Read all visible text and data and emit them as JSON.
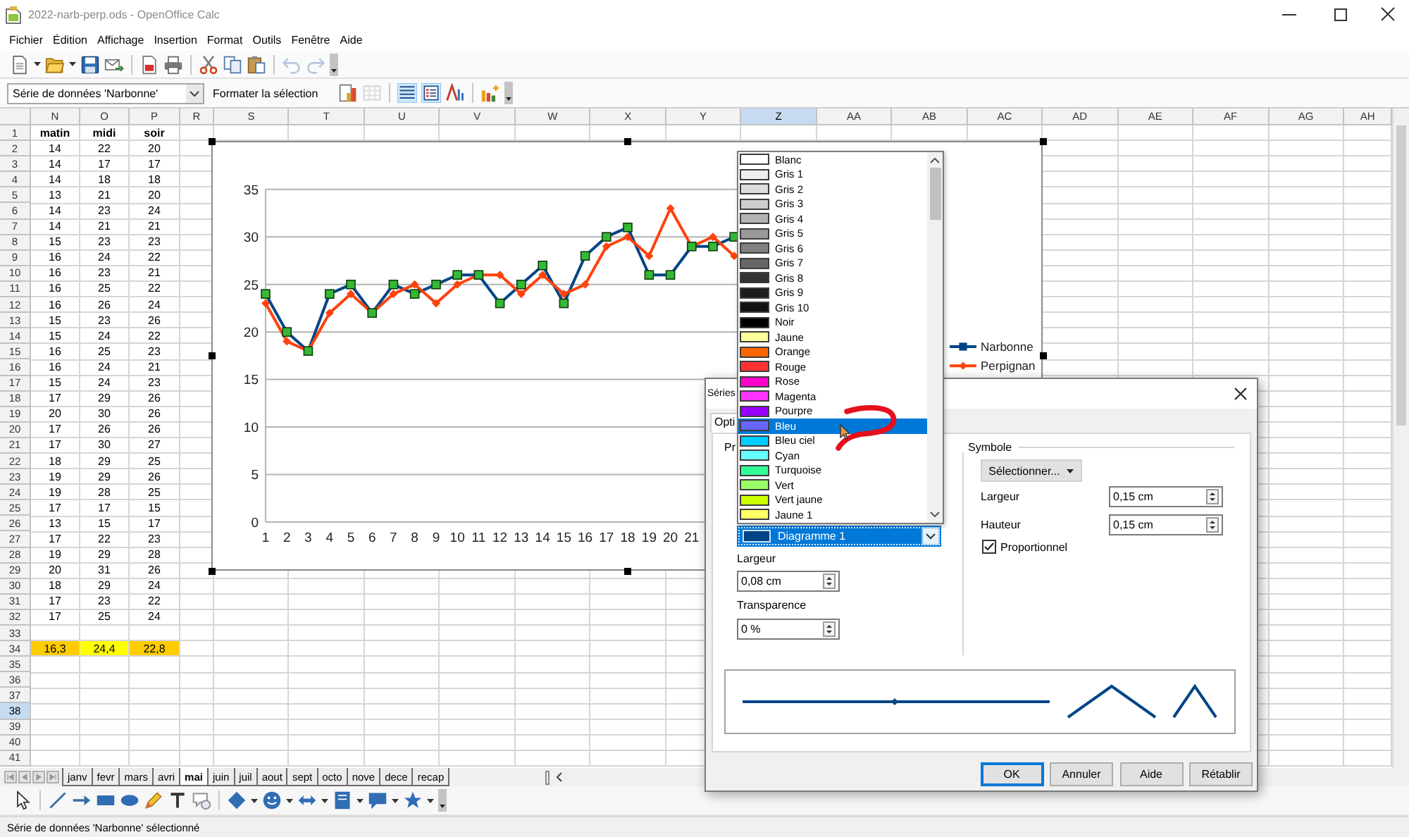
{
  "window": {
    "title": "2022-narb-perp.ods - OpenOffice Calc"
  },
  "menu": [
    "Fichier",
    "Édition",
    "Affichage",
    "Insertion",
    "Format",
    "Outils",
    "Fenêtre",
    "Aide"
  ],
  "toolbar": [
    {
      "kind": "new",
      "disabled": false
    },
    {
      "kind": "caret",
      "disabled": false
    },
    {
      "kind": "open",
      "disabled": false
    },
    {
      "kind": "caret",
      "disabled": false
    },
    {
      "kind": "save",
      "disabled": false
    },
    {
      "kind": "email",
      "disabled": false
    },
    {
      "kind": "separator"
    },
    {
      "kind": "pdf",
      "disabled": false
    },
    {
      "kind": "print",
      "disabled": false
    },
    {
      "kind": "separator"
    },
    {
      "kind": "cut",
      "disabled": false
    },
    {
      "kind": "copy",
      "disabled": false
    },
    {
      "kind": "paste",
      "disabled": false
    },
    {
      "kind": "separator"
    },
    {
      "kind": "undo",
      "disabled": true
    },
    {
      "kind": "redo",
      "disabled": true
    },
    {
      "kind": "overflow",
      "disabled": false
    }
  ],
  "format_bar": {
    "selector": "Série de données 'Narbonne'",
    "button": "Formater la sélection",
    "items": [
      {
        "kind": "chart-type",
        "disabled": false,
        "pressed": false
      },
      {
        "kind": "data-table",
        "disabled": true,
        "pressed": false
      },
      {
        "kind": "separator"
      },
      {
        "kind": "grid",
        "disabled": false,
        "pressed": true
      },
      {
        "kind": "legend",
        "disabled": false,
        "pressed": true
      },
      {
        "kind": "text-scale",
        "disabled": false,
        "pressed": false
      },
      {
        "kind": "separator"
      },
      {
        "kind": "auto-layout",
        "disabled": false,
        "pressed": false
      },
      {
        "kind": "overflow",
        "disabled": false
      }
    ]
  },
  "sheet": {
    "columns": [
      {
        "label": "N",
        "selected": false
      },
      {
        "label": "O",
        "selected": false
      },
      {
        "label": "P",
        "selected": false
      },
      {
        "label": "R",
        "selected": false
      },
      {
        "label": "S",
        "selected": false
      },
      {
        "label": "T",
        "selected": false
      },
      {
        "label": "U",
        "selected": false
      },
      {
        "label": "V",
        "selected": false
      },
      {
        "label": "W",
        "selected": false
      },
      {
        "label": "X",
        "selected": false
      },
      {
        "label": "Y",
        "selected": false
      },
      {
        "label": "Z",
        "selected": true
      },
      {
        "label": "AA",
        "selected": false
      },
      {
        "label": "AB",
        "selected": false
      },
      {
        "label": "AC",
        "selected": false
      },
      {
        "label": "AD",
        "selected": false
      },
      {
        "label": "AE",
        "selected": false
      },
      {
        "label": "AF",
        "selected": false
      },
      {
        "label": "AG",
        "selected": false
      },
      {
        "label": "AH",
        "selected": false
      }
    ],
    "rows": [
      {
        "label": "1",
        "kind": "header",
        "selected": false,
        "cells": [
          "matin",
          "midi",
          "soir"
        ]
      },
      {
        "label": "2",
        "kind": "data",
        "selected": false,
        "cells": [
          "14",
          "22",
          "20"
        ]
      },
      {
        "label": "3",
        "kind": "data",
        "selected": false,
        "cells": [
          "14",
          "17",
          "17"
        ]
      },
      {
        "label": "4",
        "kind": "data",
        "selected": false,
        "cells": [
          "14",
          "18",
          "18"
        ]
      },
      {
        "label": "5",
        "kind": "data",
        "selected": false,
        "cells": [
          "13",
          "21",
          "20"
        ]
      },
      {
        "label": "6",
        "kind": "data",
        "selected": false,
        "cells": [
          "14",
          "23",
          "24"
        ]
      },
      {
        "label": "7",
        "kind": "data",
        "selected": false,
        "cells": [
          "14",
          "21",
          "21"
        ]
      },
      {
        "label": "8",
        "kind": "data",
        "selected": false,
        "cells": [
          "15",
          "23",
          "23"
        ]
      },
      {
        "label": "9",
        "kind": "data",
        "selected": false,
        "cells": [
          "16",
          "24",
          "22"
        ]
      },
      {
        "label": "10",
        "kind": "data",
        "selected": false,
        "cells": [
          "16",
          "23",
          "21"
        ]
      },
      {
        "label": "11",
        "kind": "data",
        "selected": false,
        "cells": [
          "16",
          "25",
          "22"
        ]
      },
      {
        "label": "12",
        "kind": "data",
        "selected": false,
        "cells": [
          "16",
          "26",
          "24"
        ]
      },
      {
        "label": "13",
        "kind": "data",
        "selected": false,
        "cells": [
          "15",
          "23",
          "26"
        ]
      },
      {
        "label": "14",
        "kind": "data",
        "selected": false,
        "cells": [
          "15",
          "24",
          "22"
        ]
      },
      {
        "label": "15",
        "kind": "data",
        "selected": false,
        "cells": [
          "16",
          "25",
          "23"
        ]
      },
      {
        "label": "16",
        "kind": "data",
        "selected": false,
        "cells": [
          "16",
          "24",
          "21"
        ]
      },
      {
        "label": "17",
        "kind": "data",
        "selected": false,
        "cells": [
          "15",
          "24",
          "23"
        ]
      },
      {
        "label": "18",
        "kind": "data",
        "selected": false,
        "cells": [
          "17",
          "29",
          "26"
        ]
      },
      {
        "label": "19",
        "kind": "data",
        "selected": false,
        "cells": [
          "20",
          "30",
          "26"
        ]
      },
      {
        "label": "20",
        "kind": "data",
        "selected": false,
        "cells": [
          "17",
          "26",
          "26"
        ]
      },
      {
        "label": "21",
        "kind": "data",
        "selected": false,
        "cells": [
          "17",
          "30",
          "27"
        ]
      },
      {
        "label": "22",
        "kind": "data",
        "selected": false,
        "cells": [
          "18",
          "29",
          "25"
        ]
      },
      {
        "label": "23",
        "kind": "data",
        "selected": false,
        "cells": [
          "19",
          "29",
          "26"
        ]
      },
      {
        "label": "24",
        "kind": "data",
        "selected": false,
        "cells": [
          "19",
          "28",
          "25"
        ]
      },
      {
        "label": "25",
        "kind": "data",
        "selected": false,
        "cells": [
          "17",
          "17",
          "15"
        ]
      },
      {
        "label": "26",
        "kind": "data",
        "selected": false,
        "cells": [
          "13",
          "15",
          "17"
        ]
      },
      {
        "label": "27",
        "kind": "data",
        "selected": false,
        "cells": [
          "17",
          "22",
          "23"
        ]
      },
      {
        "label": "28",
        "kind": "data",
        "selected": false,
        "cells": [
          "19",
          "29",
          "28"
        ]
      },
      {
        "label": "29",
        "kind": "data",
        "selected": false,
        "cells": [
          "20",
          "31",
          "26"
        ]
      },
      {
        "label": "30",
        "kind": "data",
        "selected": false,
        "cells": [
          "18",
          "29",
          "24"
        ]
      },
      {
        "label": "31",
        "kind": "data",
        "selected": false,
        "cells": [
          "17",
          "23",
          "22"
        ]
      },
      {
        "label": "32",
        "kind": "data",
        "selected": false,
        "cells": [
          "17",
          "25",
          "24"
        ]
      },
      {
        "label": "33",
        "kind": "data",
        "selected": false
      },
      {
        "label": "34",
        "kind": "total",
        "selected": false,
        "cells": [
          {
            "text": "16,3",
            "color": "#ffcc00"
          },
          {
            "text": "24,4",
            "color": "#ffff00"
          },
          {
            "text": "22,8",
            "color": "#ffcc00"
          }
        ]
      },
      {
        "label": "35",
        "kind": "data",
        "selected": false
      },
      {
        "label": "36",
        "kind": "data",
        "selected": false
      },
      {
        "label": "37",
        "kind": "data",
        "selected": false
      },
      {
        "label": "38",
        "kind": "data",
        "selected": true
      },
      {
        "label": "39",
        "kind": "data",
        "selected": false
      },
      {
        "label": "40",
        "kind": "data",
        "selected": false
      },
      {
        "label": "41",
        "kind": "data",
        "selected": false
      }
    ]
  },
  "chart": {
    "series_states": [
      {
        "selected": true
      },
      {
        "selected": false
      }
    ],
    "chart_data": {
      "type": "line",
      "x": [
        1,
        2,
        3,
        4,
        5,
        6,
        7,
        8,
        9,
        10,
        11,
        12,
        13,
        14,
        15,
        16,
        17,
        18,
        19,
        20,
        21,
        22,
        23
      ],
      "xlim": [
        1,
        31
      ],
      "xticks": [
        1,
        2,
        3,
        4,
        5,
        6,
        7,
        8,
        9,
        10,
        11,
        12,
        13,
        14,
        15,
        16,
        17,
        18,
        19,
        20,
        21
      ],
      "ylim": [
        0,
        35
      ],
      "yticks": [
        0,
        5,
        10,
        15,
        20,
        25,
        30,
        35
      ],
      "grid": true,
      "legend": "right",
      "series": [
        {
          "name": "Narbonne",
          "color": "#004586",
          "marker": "square",
          "values": [
            24,
            20,
            18,
            24,
            25,
            22,
            25,
            24,
            25,
            26,
            26,
            23,
            25,
            27,
            23,
            28,
            30,
            31,
            26,
            26,
            29,
            29,
            30
          ]
        },
        {
          "name": "Perpignan",
          "color": "#ff420e",
          "marker": "diamond",
          "values": [
            23,
            19,
            18,
            22,
            24,
            22,
            24,
            25,
            23,
            25,
            26,
            26,
            24,
            26,
            24,
            25,
            29,
            30,
            28,
            33,
            29,
            30,
            28
          ]
        }
      ]
    }
  },
  "color_list": {
    "items": [
      {
        "label": "Blanc",
        "color": "#ffffff",
        "selected": false
      },
      {
        "label": "Gris 1",
        "color": "#eeeeee",
        "selected": false
      },
      {
        "label": "Gris 2",
        "color": "#dddddd",
        "selected": false
      },
      {
        "label": "Gris 3",
        "color": "#cccccc",
        "selected": false
      },
      {
        "label": "Gris 4",
        "color": "#b3b3b3",
        "selected": false
      },
      {
        "label": "Gris 5",
        "color": "#999999",
        "selected": false
      },
      {
        "label": "Gris 6",
        "color": "#808080",
        "selected": false
      },
      {
        "label": "Gris 7",
        "color": "#666666",
        "selected": false
      },
      {
        "label": "Gris 8",
        "color": "#333333",
        "selected": false
      },
      {
        "label": "Gris 9",
        "color": "#1c1c1c",
        "selected": false
      },
      {
        "label": "Gris 10",
        "color": "#111111",
        "selected": false
      },
      {
        "label": "Noir",
        "color": "#000000",
        "selected": false
      },
      {
        "label": "Jaune",
        "color": "#ffff99",
        "selected": false
      },
      {
        "label": "Orange",
        "color": "#ff6600",
        "selected": false
      },
      {
        "label": "Rouge",
        "color": "#ff3333",
        "selected": false
      },
      {
        "label": "Rose",
        "color": "#ff00cc",
        "selected": false
      },
      {
        "label": "Magenta",
        "color": "#ff33ff",
        "selected": false
      },
      {
        "label": "Pourpre",
        "color": "#9900ff",
        "selected": false
      },
      {
        "label": "Bleu",
        "color": "#6666ff",
        "selected": true
      },
      {
        "label": "Bleu ciel",
        "color": "#00ccff",
        "selected": false
      },
      {
        "label": "Cyan",
        "color": "#66ffff",
        "selected": false
      },
      {
        "label": "Turquoise",
        "color": "#33ff99",
        "selected": false
      },
      {
        "label": "Vert",
        "color": "#99ff66",
        "selected": false
      },
      {
        "label": "Vert jaune",
        "color": "#ccff00",
        "selected": false
      },
      {
        "label": "Jaune 1",
        "color": "#ffff66",
        "selected": false
      }
    ]
  },
  "dialog": {
    "title": "Séries",
    "tabs": [
      {
        "label": "Opti",
        "selected": true
      }
    ],
    "line_group": {
      "title": "Pr",
      "line_color": {
        "label": "Diagramme 1",
        "color": "#004586"
      },
      "fields": [
        {
          "label": "Largeur",
          "value": "0,08 cm"
        },
        {
          "label": "Transparence",
          "value": "0 %"
        }
      ]
    },
    "symbol_group": {
      "title": "Symbole",
      "select_button": "Sélectionner...",
      "fields": [
        {
          "label": "Largeur",
          "value": "0,15 cm"
        },
        {
          "label": "Hauteur",
          "value": "0,15 cm"
        }
      ],
      "proportional": {
        "label": "Proportionnel",
        "checked": true
      }
    },
    "buttons": [
      {
        "label": "OK",
        "default": true
      },
      {
        "label": "Annuler",
        "default": false
      },
      {
        "label": "Aide",
        "default": false
      },
      {
        "label": "Rétablir",
        "default": false
      }
    ]
  },
  "sheet_tabs": [
    {
      "label": "janv",
      "selected": false
    },
    {
      "label": "fevr",
      "selected": false
    },
    {
      "label": "mars",
      "selected": false
    },
    {
      "label": "avri",
      "selected": false
    },
    {
      "label": "mai",
      "selected": true
    },
    {
      "label": "juin",
      "selected": false
    },
    {
      "label": "juil",
      "selected": false
    },
    {
      "label": "aout",
      "selected": false
    },
    {
      "label": "sept",
      "selected": false
    },
    {
      "label": "octo",
      "selected": false
    },
    {
      "label": "nove",
      "selected": false
    },
    {
      "label": "dece",
      "selected": false
    },
    {
      "label": "recap",
      "selected": false
    }
  ],
  "drawing_toolbar": [
    {
      "kind": "select"
    },
    {
      "kind": "separator"
    },
    {
      "kind": "line"
    },
    {
      "kind": "arrow"
    },
    {
      "kind": "rect"
    },
    {
      "kind": "ellipse"
    },
    {
      "kind": "freeform"
    },
    {
      "kind": "text"
    },
    {
      "kind": "callout"
    },
    {
      "kind": "separator"
    },
    {
      "kind": "diamond"
    },
    {
      "kind": "caret"
    },
    {
      "kind": "smiley"
    },
    {
      "kind": "caret"
    },
    {
      "kind": "double-arrow"
    },
    {
      "kind": "caret"
    },
    {
      "kind": "flowchart"
    },
    {
      "kind": "caret"
    },
    {
      "kind": "bubble"
    },
    {
      "kind": "caret"
    },
    {
      "kind": "star"
    },
    {
      "kind": "caret"
    },
    {
      "kind": "overflow"
    }
  ],
  "status_bar": {
    "text": "Série de données 'Narbonne' sélectionné"
  }
}
